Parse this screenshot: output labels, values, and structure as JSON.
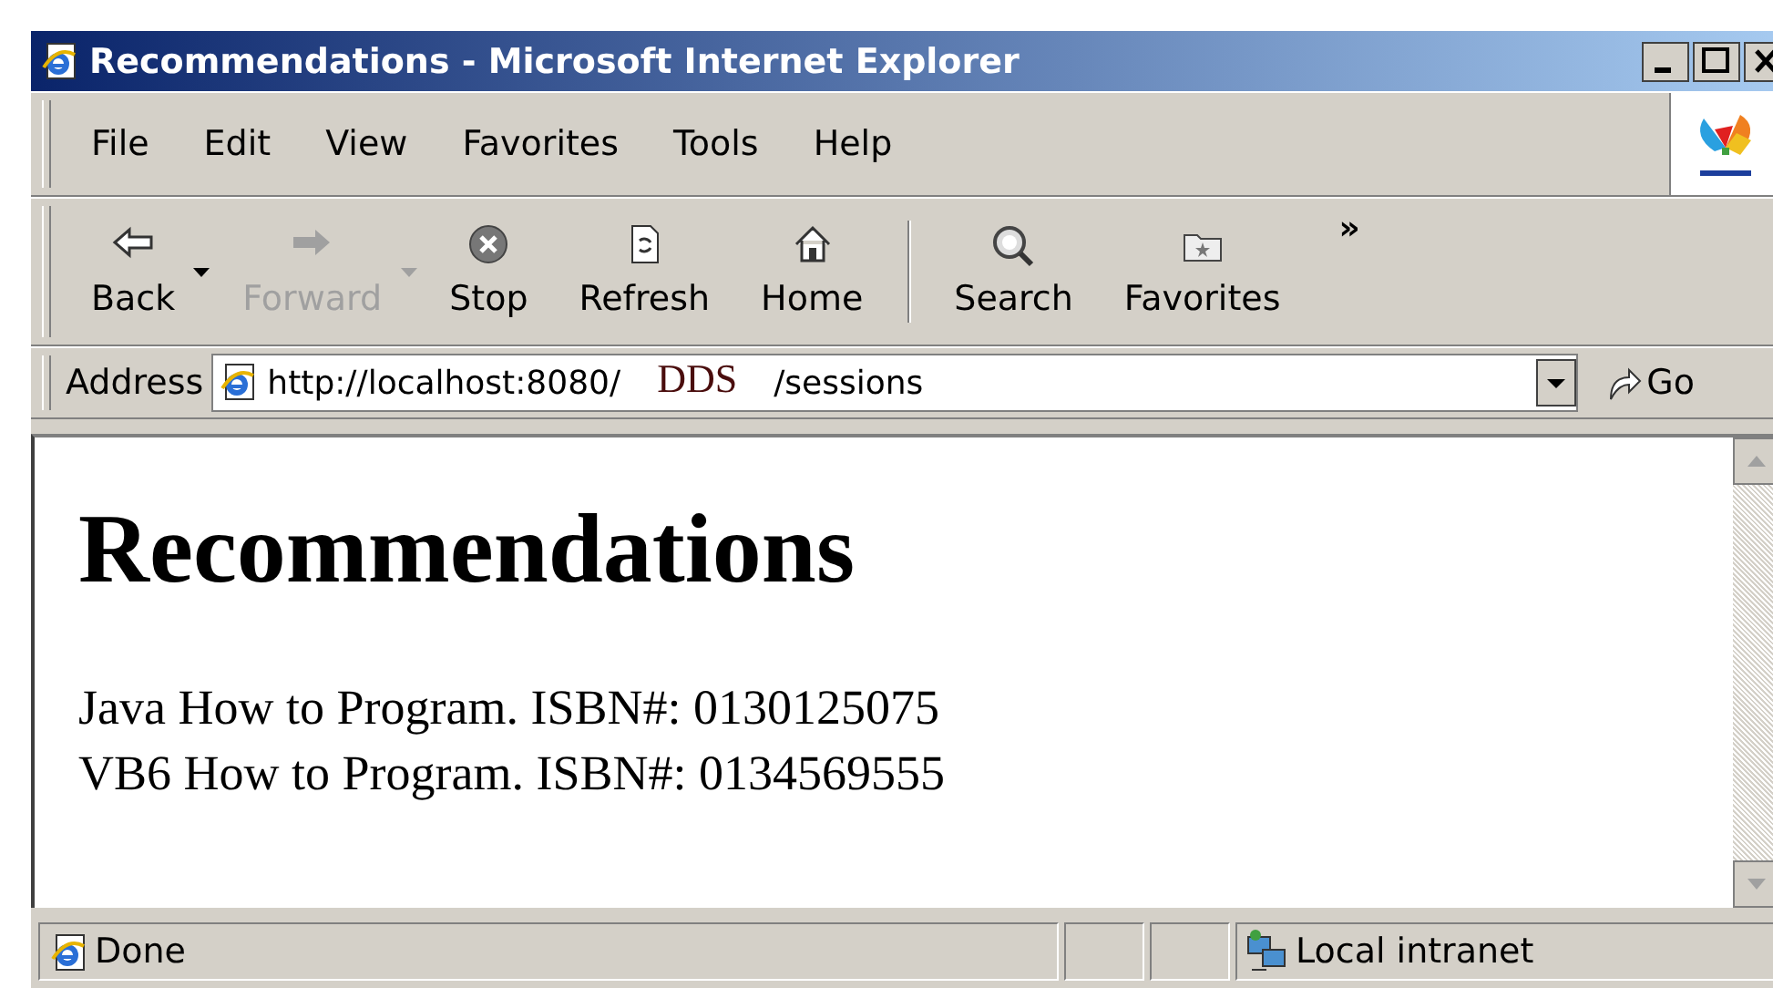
{
  "window": {
    "title": "Recommendations - Microsoft Internet Explorer"
  },
  "menu_bar": [
    "File",
    "Edit",
    "View",
    "Favorites",
    "Tools",
    "Help"
  ],
  "toolbar": [
    {
      "label": "Back",
      "kind": "back",
      "disabled": false,
      "dropdown": true
    },
    {
      "label": "Forward",
      "kind": "forward",
      "disabled": true,
      "dropdown": true
    },
    {
      "label": "Stop",
      "kind": "stop",
      "disabled": false,
      "dropdown": false
    },
    {
      "label": "Refresh",
      "kind": "refresh",
      "disabled": false,
      "dropdown": false
    },
    {
      "label": "Home",
      "kind": "home",
      "disabled": false,
      "dropdown": false
    },
    {
      "kind": "separator"
    },
    {
      "label": "Search",
      "kind": "search",
      "disabled": false,
      "dropdown": false
    },
    {
      "label": "Favorites",
      "kind": "favorites",
      "disabled": false,
      "dropdown": false
    }
  ],
  "toolbar_more": "»",
  "address_bar": {
    "label": "Address",
    "url_start": "http://localhost:8080/",
    "url_overlay": "DDS",
    "url_end": "/sessions",
    "go": "Go"
  },
  "page": {
    "heading": "Recommendations",
    "lines": [
      "Java How to Program. ISBN#: 0130125075",
      "VB6 How to Program. ISBN#: 0134569555"
    ]
  },
  "status_bar": {
    "text": "Done",
    "zone": "Local intranet"
  }
}
